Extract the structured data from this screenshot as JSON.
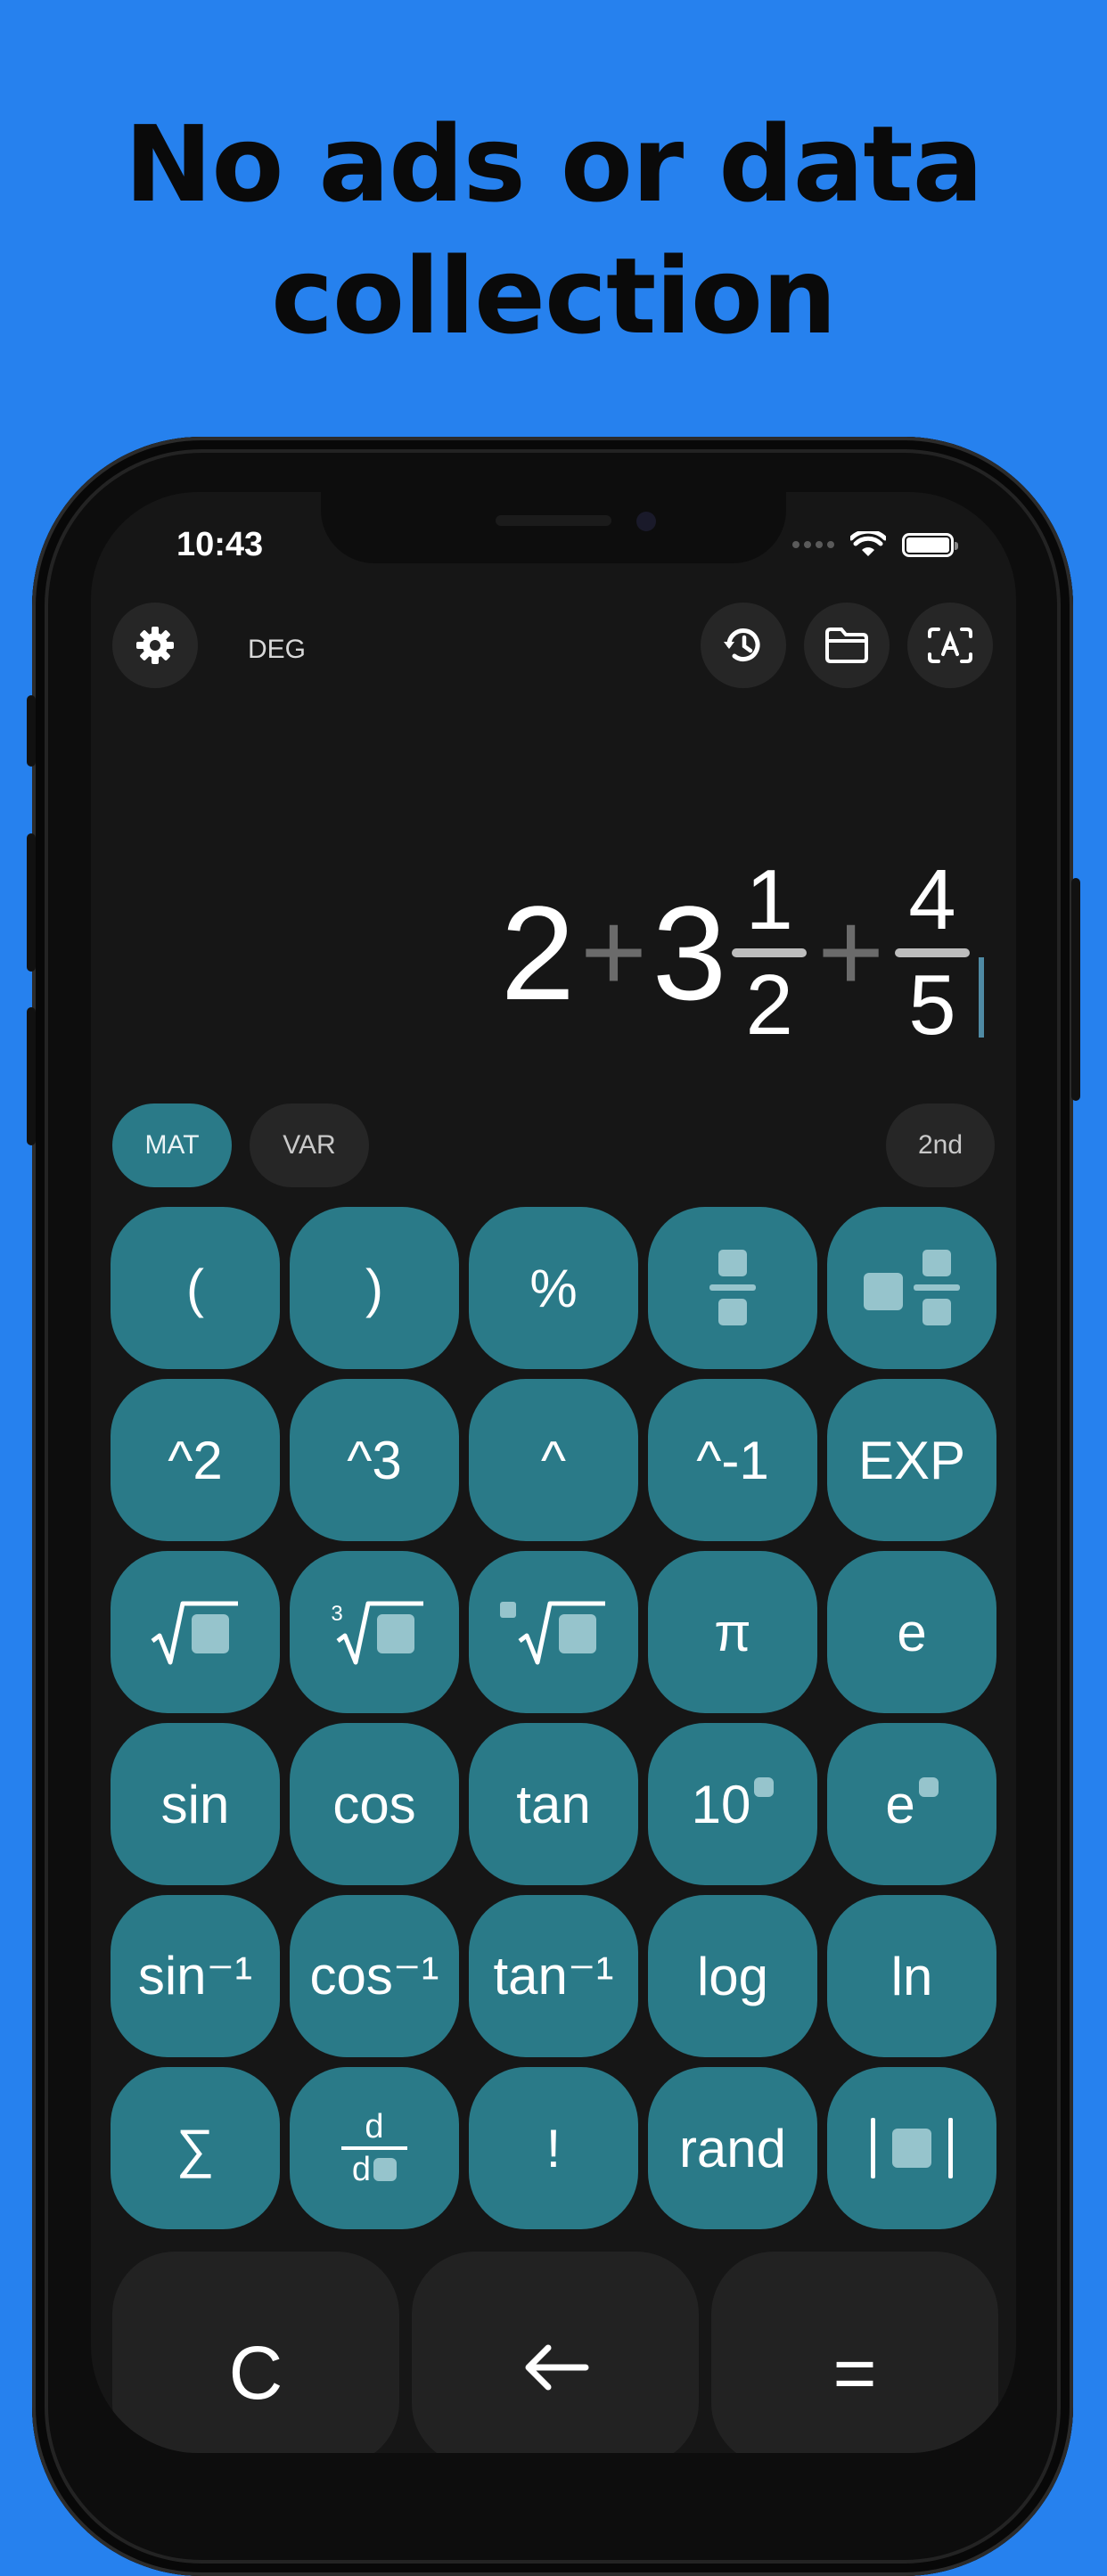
{
  "promo": {
    "line1": "No ads or data",
    "line2": "collection"
  },
  "status_bar": {
    "time": "10:43"
  },
  "toolbar": {
    "angle_mode": "DEG",
    "buttons": [
      "settings-gear-icon",
      "history-icon",
      "folder-icon",
      "text-recognition-icon"
    ]
  },
  "expression": {
    "whole1": "2",
    "op1": "+",
    "whole2": "3",
    "frac1_num": "1",
    "frac1_den": "2",
    "op2": "+",
    "frac2_num": "4",
    "frac2_den": "5"
  },
  "mode_tabs": {
    "mat": "MAT",
    "var": "VAR",
    "second": "2nd"
  },
  "keys": {
    "lparen": "(",
    "rparen": ")",
    "percent": "%",
    "sq": "^2",
    "cube": "^3",
    "pow": "^",
    "inv": "^-1",
    "exp": "EXP",
    "cbrt_index": "3",
    "pi": "π",
    "e": "e",
    "sin": "sin",
    "cos": "cos",
    "tan": "tan",
    "ten": "10",
    "e_pow": "e",
    "asin": "sin⁻¹",
    "acos": "cos⁻¹",
    "atan": "tan⁻¹",
    "log": "log",
    "ln": "ln",
    "sum": "∑",
    "deriv_top": "d",
    "deriv_bottom": "d",
    "fact": "!",
    "rand": "rand"
  },
  "bottom_keys": {
    "clear": "C",
    "equals": "="
  },
  "colors": {
    "background": "#2681ee",
    "key": "#2a7a88",
    "screen": "#161616",
    "dark_key": "#222222",
    "cursor": "#4f8aa4"
  }
}
